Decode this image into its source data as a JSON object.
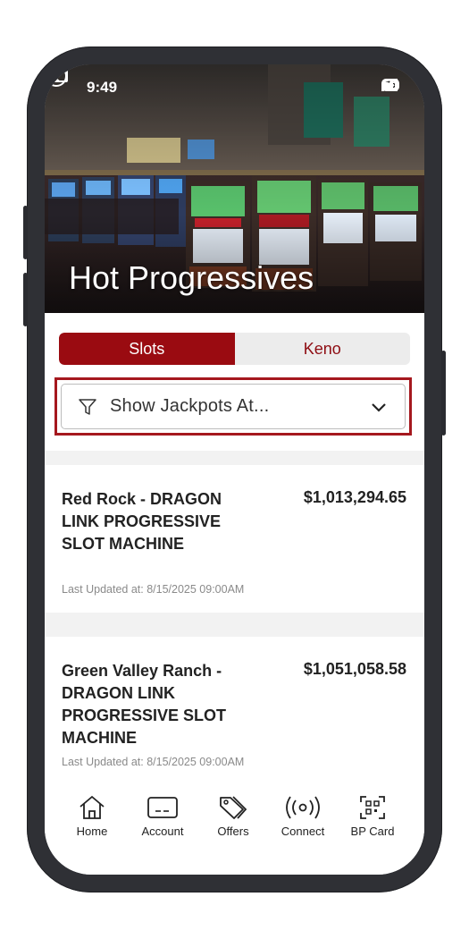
{
  "status_bar": {
    "time": "9:49",
    "battery": "76"
  },
  "header": {
    "title": "Hot Progressives"
  },
  "segments": {
    "active": "Slots",
    "inactive": "Keno"
  },
  "filter": {
    "label": "Show Jackpots At..."
  },
  "jackpots": [
    {
      "name": "Red Rock - DRAGON LINK PROGRESSIVE SLOT MACHINE",
      "amount": "$1,013,294.65",
      "updated": "Last Updated at: 8/15/2025 09:00AM"
    },
    {
      "name": "Green Valley Ranch - DRAGON LINK PROGRESSIVE SLOT MACHINE",
      "amount": "$1,051,058.58",
      "updated": "Last Updated at: 8/15/2025 09:00AM"
    }
  ],
  "tabbar": [
    {
      "label": "Home",
      "icon": "home-icon"
    },
    {
      "label": "Account",
      "icon": "card-icon"
    },
    {
      "label": "Offers",
      "icon": "tag-icon"
    },
    {
      "label": "Connect",
      "icon": "broadcast-icon"
    },
    {
      "label": "BP Card",
      "icon": "qr-scan-icon"
    }
  ],
  "colors": {
    "brand": "#9a0b11",
    "highlight_border": "#a5181e"
  }
}
